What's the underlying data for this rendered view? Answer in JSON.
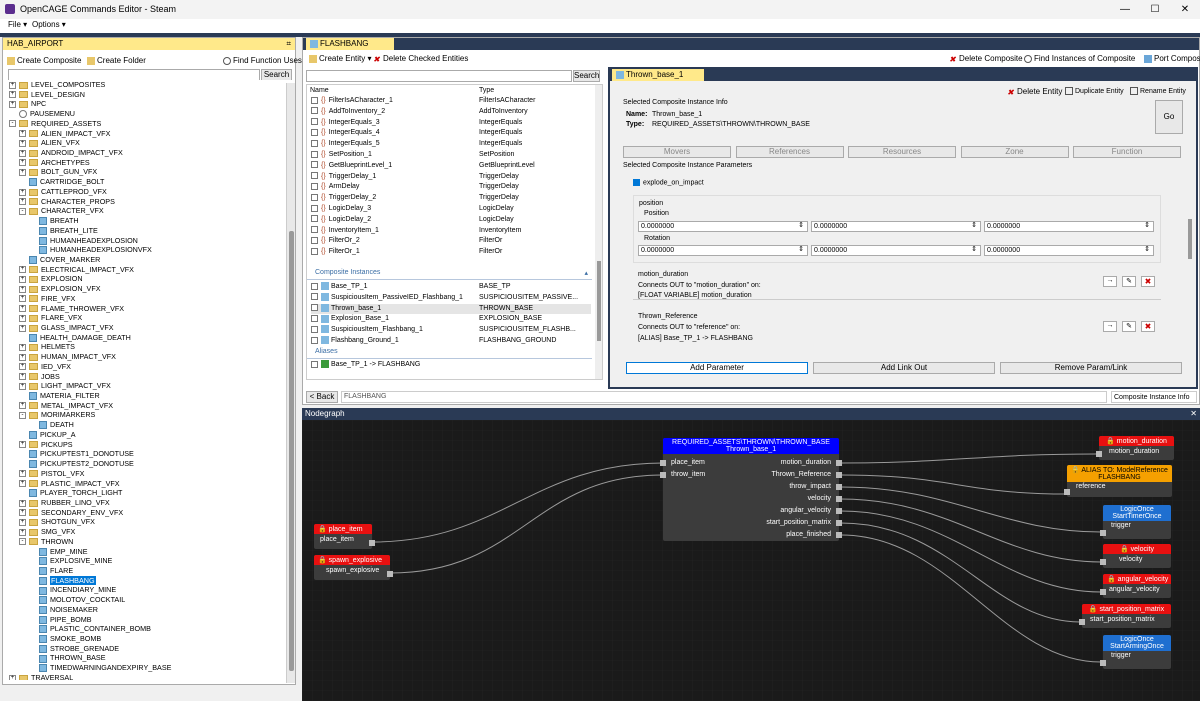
{
  "window": {
    "title": "OpenCAGE Commands Editor - Steam",
    "minimize": "—",
    "maximize": "☐",
    "close": "✕"
  },
  "menu": {
    "file": "File ▾",
    "options": "Options ▾"
  },
  "left": {
    "title": "HAB_AIRPORT",
    "pin": "⌗",
    "create_composite": "Create Composite",
    "create_folder": "Create Folder",
    "find_function": "Find Function Uses",
    "search": "Search",
    "search_value": "",
    "tree": [
      {
        "d": 0,
        "k": "f",
        "e": "+",
        "t": "LEVEL_COMPOSITES"
      },
      {
        "d": 0,
        "k": "f",
        "e": "+",
        "t": "LEVEL_DESIGN"
      },
      {
        "d": 0,
        "k": "f",
        "e": "+",
        "t": "NPC"
      },
      {
        "d": 0,
        "k": "g",
        "e": "",
        "t": "PAUSEMENU"
      },
      {
        "d": 0,
        "k": "f",
        "e": "-",
        "t": "REQUIRED_ASSETS"
      },
      {
        "d": 1,
        "k": "f",
        "e": "+",
        "t": "ALIEN_IMPACT_VFX"
      },
      {
        "d": 1,
        "k": "f",
        "e": "+",
        "t": "ALIEN_VFX"
      },
      {
        "d": 1,
        "k": "f",
        "e": "+",
        "t": "ANDROID_IMPACT_VFX"
      },
      {
        "d": 1,
        "k": "f",
        "e": "+",
        "t": "ARCHETYPES"
      },
      {
        "d": 1,
        "k": "f",
        "e": "+",
        "t": "BOLT_GUN_VFX"
      },
      {
        "d": 1,
        "k": "c",
        "e": "",
        "t": "CARTRIDGE_BOLT"
      },
      {
        "d": 1,
        "k": "f",
        "e": "+",
        "t": "CATTLEPROD_VFX"
      },
      {
        "d": 1,
        "k": "f",
        "e": "+",
        "t": "CHARACTER_PROPS"
      },
      {
        "d": 1,
        "k": "f",
        "e": "-",
        "t": "CHARACTER_VFX"
      },
      {
        "d": 2,
        "k": "c",
        "e": "",
        "t": "BREATH"
      },
      {
        "d": 2,
        "k": "c",
        "e": "",
        "t": "BREATH_LITE"
      },
      {
        "d": 2,
        "k": "c",
        "e": "",
        "t": "HUMANHEADEXPLOSION"
      },
      {
        "d": 2,
        "k": "c",
        "e": "",
        "t": "HUMANHEADEXPLOSIONVFX"
      },
      {
        "d": 1,
        "k": "c",
        "e": "",
        "t": "COVER_MARKER"
      },
      {
        "d": 1,
        "k": "f",
        "e": "+",
        "t": "ELECTRICAL_IMPACT_VFX"
      },
      {
        "d": 1,
        "k": "f",
        "e": "+",
        "t": "EXPLOSION"
      },
      {
        "d": 1,
        "k": "f",
        "e": "+",
        "t": "EXPLOSION_VFX"
      },
      {
        "d": 1,
        "k": "f",
        "e": "+",
        "t": "FIRE_VFX"
      },
      {
        "d": 1,
        "k": "f",
        "e": "+",
        "t": "FLAME_THROWER_VFX"
      },
      {
        "d": 1,
        "k": "f",
        "e": "+",
        "t": "FLARE_VFX"
      },
      {
        "d": 1,
        "k": "f",
        "e": "+",
        "t": "GLASS_IMPACT_VFX"
      },
      {
        "d": 1,
        "k": "c",
        "e": "",
        "t": "HEALTH_DAMAGE_DEATH"
      },
      {
        "d": 1,
        "k": "f",
        "e": "+",
        "t": "HELMETS"
      },
      {
        "d": 1,
        "k": "f",
        "e": "+",
        "t": "HUMAN_IMPACT_VFX"
      },
      {
        "d": 1,
        "k": "f",
        "e": "+",
        "t": "IED_VFX"
      },
      {
        "d": 1,
        "k": "f",
        "e": "+",
        "t": "JOBS"
      },
      {
        "d": 1,
        "k": "f",
        "e": "+",
        "t": "LIGHT_IMPACT_VFX"
      },
      {
        "d": 1,
        "k": "c",
        "e": "",
        "t": "MATERIA_FILTER"
      },
      {
        "d": 1,
        "k": "f",
        "e": "+",
        "t": "METAL_IMPACT_VFX"
      },
      {
        "d": 1,
        "k": "f",
        "e": "-",
        "t": "MORIMARKERS"
      },
      {
        "d": 2,
        "k": "c",
        "e": "",
        "t": "DEATH"
      },
      {
        "d": 1,
        "k": "c",
        "e": "",
        "t": "PICKUP_A"
      },
      {
        "d": 1,
        "k": "f",
        "e": "+",
        "t": "PICKUPS"
      },
      {
        "d": 1,
        "k": "c",
        "e": "",
        "t": "PICKUPTEST1_DONOTUSE"
      },
      {
        "d": 1,
        "k": "c",
        "e": "",
        "t": "PICKUPTEST2_DONOTUSE"
      },
      {
        "d": 1,
        "k": "f",
        "e": "+",
        "t": "PISTOL_VFX"
      },
      {
        "d": 1,
        "k": "f",
        "e": "+",
        "t": "PLASTIC_IMPACT_VFX"
      },
      {
        "d": 1,
        "k": "c",
        "e": "",
        "t": "PLAYER_TORCH_LIGHT"
      },
      {
        "d": 1,
        "k": "f",
        "e": "+",
        "t": "RUBBER_LINO_VFX"
      },
      {
        "d": 1,
        "k": "f",
        "e": "+",
        "t": "SECONDARY_ENV_VFX"
      },
      {
        "d": 1,
        "k": "f",
        "e": "+",
        "t": "SHOTGUN_VFX"
      },
      {
        "d": 1,
        "k": "f",
        "e": "+",
        "t": "SMG_VFX"
      },
      {
        "d": 1,
        "k": "f",
        "e": "-",
        "t": "THROWN"
      },
      {
        "d": 2,
        "k": "c",
        "e": "",
        "t": "EMP_MINE"
      },
      {
        "d": 2,
        "k": "c",
        "e": "",
        "t": "EXPLOSIVE_MINE"
      },
      {
        "d": 2,
        "k": "c",
        "e": "",
        "t": "FLARE"
      },
      {
        "d": 2,
        "k": "c",
        "e": "",
        "t": "FLASHBANG",
        "sel": true
      },
      {
        "d": 2,
        "k": "c",
        "e": "",
        "t": "INCENDIARY_MINE"
      },
      {
        "d": 2,
        "k": "c",
        "e": "",
        "t": "MOLOTOV_COCKTAIL"
      },
      {
        "d": 2,
        "k": "c",
        "e": "",
        "t": "NOISEMAKER"
      },
      {
        "d": 2,
        "k": "c",
        "e": "",
        "t": "PIPE_BOMB"
      },
      {
        "d": 2,
        "k": "c",
        "e": "",
        "t": "PLASTIC_CONTAINER_BOMB"
      },
      {
        "d": 2,
        "k": "c",
        "e": "",
        "t": "SMOKE_BOMB"
      },
      {
        "d": 2,
        "k": "c",
        "e": "",
        "t": "STROBE_GRENADE"
      },
      {
        "d": 2,
        "k": "c",
        "e": "",
        "t": "THROWN_BASE"
      },
      {
        "d": 2,
        "k": "c",
        "e": "",
        "t": "TIMEDWARNINGANDEXPIRY_BASE"
      },
      {
        "d": 0,
        "k": "f",
        "e": "+",
        "t": "TRAVERSAL"
      }
    ]
  },
  "mid": {
    "tab": "FLASHBANG",
    "create_entity": "Create Entity ▾",
    "delete_checked": "Delete Checked Entities",
    "search": "Search",
    "col_name": "Name",
    "col_type": "Type",
    "entities": [
      {
        "n": "FilterIsACharacter_1",
        "t": "FilterIsACharacter"
      },
      {
        "n": "AddToInventory_2",
        "t": "AddToInventory"
      },
      {
        "n": "IntegerEquals_3",
        "t": "IntegerEquals"
      },
      {
        "n": "IntegerEquals_4",
        "t": "IntegerEquals"
      },
      {
        "n": "IntegerEquals_5",
        "t": "IntegerEquals"
      },
      {
        "n": "SetPosition_1",
        "t": "SetPosition"
      },
      {
        "n": "GetBlueprintLevel_1",
        "t": "GetBlueprintLevel"
      },
      {
        "n": "TriggerDelay_1",
        "t": "TriggerDelay"
      },
      {
        "n": "ArmDelay",
        "t": "TriggerDelay"
      },
      {
        "n": "TriggerDelay_2",
        "t": "TriggerDelay"
      },
      {
        "n": "LogicDelay_3",
        "t": "LogicDelay"
      },
      {
        "n": "LogicDelay_2",
        "t": "LogicDelay"
      },
      {
        "n": "InventoryItem_1",
        "t": "InventoryItem"
      },
      {
        "n": "FilterOr_2",
        "t": "FilterOr"
      },
      {
        "n": "FilterOr_1",
        "t": "FilterOr"
      }
    ],
    "composite_header": "Composite Instances",
    "composites": [
      {
        "n": "Base_TP_1",
        "t": "BASE_TP"
      },
      {
        "n": "SuspiciousItem_PassiveIED_Flashbang_1",
        "t": "SUSPICIOUSITEM_PASSIVE..."
      },
      {
        "n": "Thrown_base_1",
        "t": "THROWN_BASE"
      },
      {
        "n": "Explosion_Base_1",
        "t": "EXPLOSION_BASE"
      },
      {
        "n": "SuspiciousItem_Flashbang_1",
        "t": "SUSPICIOUSITEM_FLASHB..."
      },
      {
        "n": "Flashbang_Ground_1",
        "t": "FLASHBANG_GROUND"
      }
    ],
    "alias_header": "Aliases",
    "alias": "Base_TP_1 -> FLASHBANG",
    "back": "< Back",
    "path": "FLASHBANG"
  },
  "right": {
    "delete_composite": "Delete Composite",
    "find_instances": "Find Instances of Composite",
    "port_composite": "Port Composite",
    "tab": "Thrown_base_1",
    "delete_entity": "Delete Entity",
    "duplicate_entity": "Duplicate Entity",
    "rename_entity": "Rename Entity",
    "info_header": "Selected Composite Instance Info",
    "name_label": "Name:",
    "name_value": "Thrown_base_1",
    "type_label": "Type:",
    "type_value": "REQUIRED_ASSETS\\THROWN\\THROWN_BASE",
    "go": "Go",
    "tabs": [
      "Movers",
      "References",
      "Resources",
      "Zone",
      "Function"
    ],
    "params_header": "Selected Composite Instance Parameters",
    "explode": "explode_on_impact",
    "position_header": "position",
    "pos_label": "Position",
    "rot_label": "Rotation",
    "pos": [
      "0.0000000",
      "0.0000000",
      "0.0000000"
    ],
    "rot": [
      "0.0000000",
      "0.0000000",
      "0.0000000"
    ],
    "motion_header": "motion_duration",
    "motion_conn": "Connects OUT to \"motion_duration\" on:",
    "motion_val": "[FLOAT VARIABLE] motion_duration",
    "thrown_header": "Thrown_Reference",
    "thrown_conn": "Connects OUT to \"reference\" on:",
    "thrown_val": "[ALIAS] Base_TP_1 -> FLASHBANG",
    "add_param": "Add Parameter",
    "add_link": "Add Link Out",
    "remove": "Remove Param/Link",
    "footer": "Composite Instance Info"
  },
  "nodegraph": {
    "title": "Nodegraph",
    "main_title": "REQUIRED_ASSETS\\THROWN\\THROWN_BASE",
    "main_sub": "Thrown_base_1",
    "main_in": [
      "place_item",
      "throw_item"
    ],
    "main_out": [
      "motion_duration",
      "Thrown_Reference",
      "throw_impact",
      "velocity",
      "angular_velocity",
      "start_position_matrix",
      "place_finished"
    ],
    "place_item": "place_item",
    "spawn_explosive": "spawn_explosive",
    "r_motion": "motion_duration",
    "alias_title": "ALIAS TO: ModelReference",
    "alias_sub": "FLASHBANG",
    "alias_port": "reference",
    "lo1_title": "LogicOnce",
    "lo1_sub": "StartTimerOnce",
    "trigger": "trigger",
    "r_velocity": "velocity",
    "r_angular": "angular_velocity",
    "r_start": "start_position_matrix",
    "lo2_title": "LogicOnce",
    "lo2_sub": "StartArmingOnce"
  },
  "colors": {
    "accent": "#0078d7",
    "brand": "#5b2d8e",
    "pin_yellow": "#ffe98a",
    "dark_header": "#2a3a55",
    "node_red": "#e81010",
    "node_blue": "#0000ff",
    "node_orange": "#f5a000",
    "node_lblue": "#1f6fd0"
  }
}
